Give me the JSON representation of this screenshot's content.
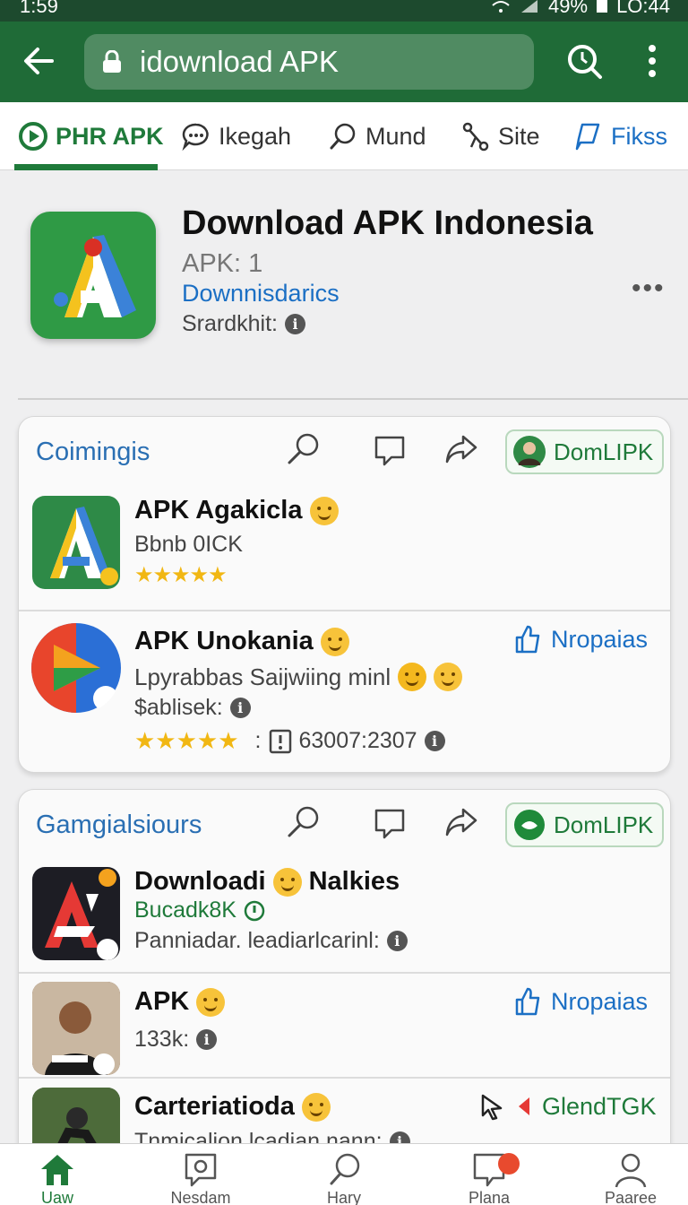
{
  "status_bar": {
    "time": "1:59",
    "battery": "49%",
    "clock": "LO:44"
  },
  "app_bar": {
    "url": "idownload APK"
  },
  "tabs": [
    {
      "label": "PHR APK",
      "icon": "play-circle-icon"
    },
    {
      "label": "Ikegah",
      "icon": "chat-bubble-icon"
    },
    {
      "label": "Mund",
      "icon": "search-icon"
    },
    {
      "label": "Site",
      "icon": "share-icon"
    },
    {
      "label": "Fikss",
      "icon": "bookmark-icon"
    }
  ],
  "header": {
    "title": "Download APK Indonesia",
    "subtitle": "APK: 1",
    "link": "Downnisdarics",
    "meta": "Srardkhit:"
  },
  "sections": [
    {
      "title": "Coimingis",
      "pill": "DomLIPK",
      "apps": [
        {
          "name": "APK Agakicla",
          "line1": "Bbnb 0ICK",
          "stars": "★★★★★"
        },
        {
          "name": "APK Unokania",
          "line1": "Lpyrabbas  Saijwiing minl",
          "line2": "$ablisek:",
          "stars": "★★★★★",
          "count": "63007:2307",
          "side": "Nropaias"
        }
      ]
    },
    {
      "title": "Gamgialsiours",
      "pill": "DomLIPK",
      "apps": [
        {
          "name": "Downloadi",
          "name2": "Nalkies",
          "line1": "Bucadk8K",
          "line2": "Panniadar. leadiarlcarinl:"
        },
        {
          "name": "APK",
          "line1": "133k:",
          "side": "Nropaias"
        },
        {
          "name": "Carteriatioda",
          "line1": "Tnmicalion lcadian nann:",
          "side": "GlendTGK"
        }
      ]
    }
  ],
  "bottom_nav": [
    {
      "label": "Uaw",
      "icon": "home-icon"
    },
    {
      "label": "Nesdam",
      "icon": "message-icon"
    },
    {
      "label": "Hary",
      "icon": "search-icon"
    },
    {
      "label": "Plana",
      "icon": "notification-icon"
    },
    {
      "label": "Paaree",
      "icon": "profile-icon"
    }
  ],
  "colors": {
    "brand": "#1f6b37",
    "accent": "#1f7a3a",
    "link": "#1b6fc4",
    "star": "#f1b713"
  }
}
